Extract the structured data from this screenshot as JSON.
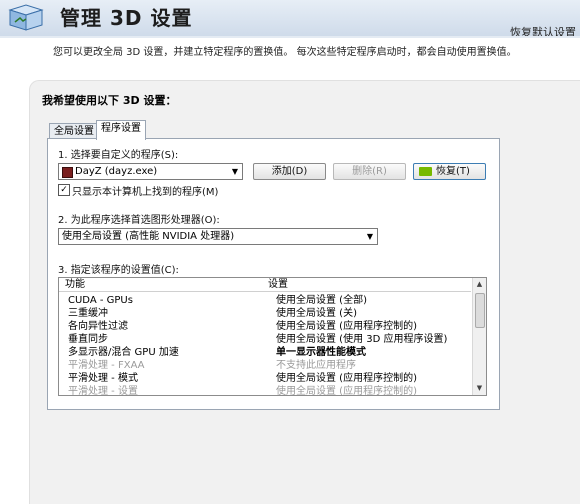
{
  "header": {
    "title": "管理 3D 设置",
    "restore_defaults": "恢复默认设置"
  },
  "description": "您可以更改全局 3D 设置，并建立特定程序的置换值。 每次这些特定程序启动时，都会自动使用置换值。",
  "section_title": "我希望使用以下 3D 设置：",
  "tabs": [
    {
      "label": "全局设置",
      "active": false
    },
    {
      "label": "程序设置",
      "active": true
    }
  ],
  "step1": {
    "label": "1. 选择要自定义的程序(S):",
    "program_value": "DayZ (dayz.exe)",
    "add_button": "添加(D)",
    "remove_button": "删除(R)",
    "restore_button": "恢复(T)",
    "show_only_checkbox": "只显示本计算机上找到的程序(M)",
    "show_only_checked": true
  },
  "step2": {
    "label": "2. 为此程序选择首选图形处理器(O):",
    "processor_value": "使用全局设置 (高性能 NVIDIA 处理器)"
  },
  "step3": {
    "label": "3. 指定该程序的设置值(C):",
    "columns": [
      "功能",
      "设置"
    ],
    "rows": [
      {
        "feature": "CUDA - GPUs",
        "setting": "使用全局设置 (全部)",
        "dim": false,
        "bold": false
      },
      {
        "feature": "三重缓冲",
        "setting": "使用全局设置 (关)",
        "dim": false,
        "bold": false
      },
      {
        "feature": "各向异性过滤",
        "setting": "使用全局设置 (应用程序控制的)",
        "dim": false,
        "bold": false
      },
      {
        "feature": "垂直同步",
        "setting": "使用全局设置 (使用 3D 应用程序设置)",
        "dim": false,
        "bold": false
      },
      {
        "feature": "多显示器/混合 GPU 加速",
        "setting": "单一显示器性能模式",
        "dim": false,
        "bold": true
      },
      {
        "feature": "平滑处理 - FXAA",
        "setting": "不支持此应用程序",
        "dim": true,
        "bold": false
      },
      {
        "feature": "平滑处理 - 模式",
        "setting": "使用全局设置 (应用程序控制的)",
        "dim": false,
        "bold": false
      },
      {
        "feature": "平滑处理 - 设置",
        "setting": "使用全局设置 (应用程序控制的)",
        "dim": true,
        "bold": false
      }
    ]
  },
  "icons": {
    "logo": "nvidia-3d-cube-icon",
    "program": "dayz-app-icon",
    "restore": "nvidia-logo-icon"
  }
}
